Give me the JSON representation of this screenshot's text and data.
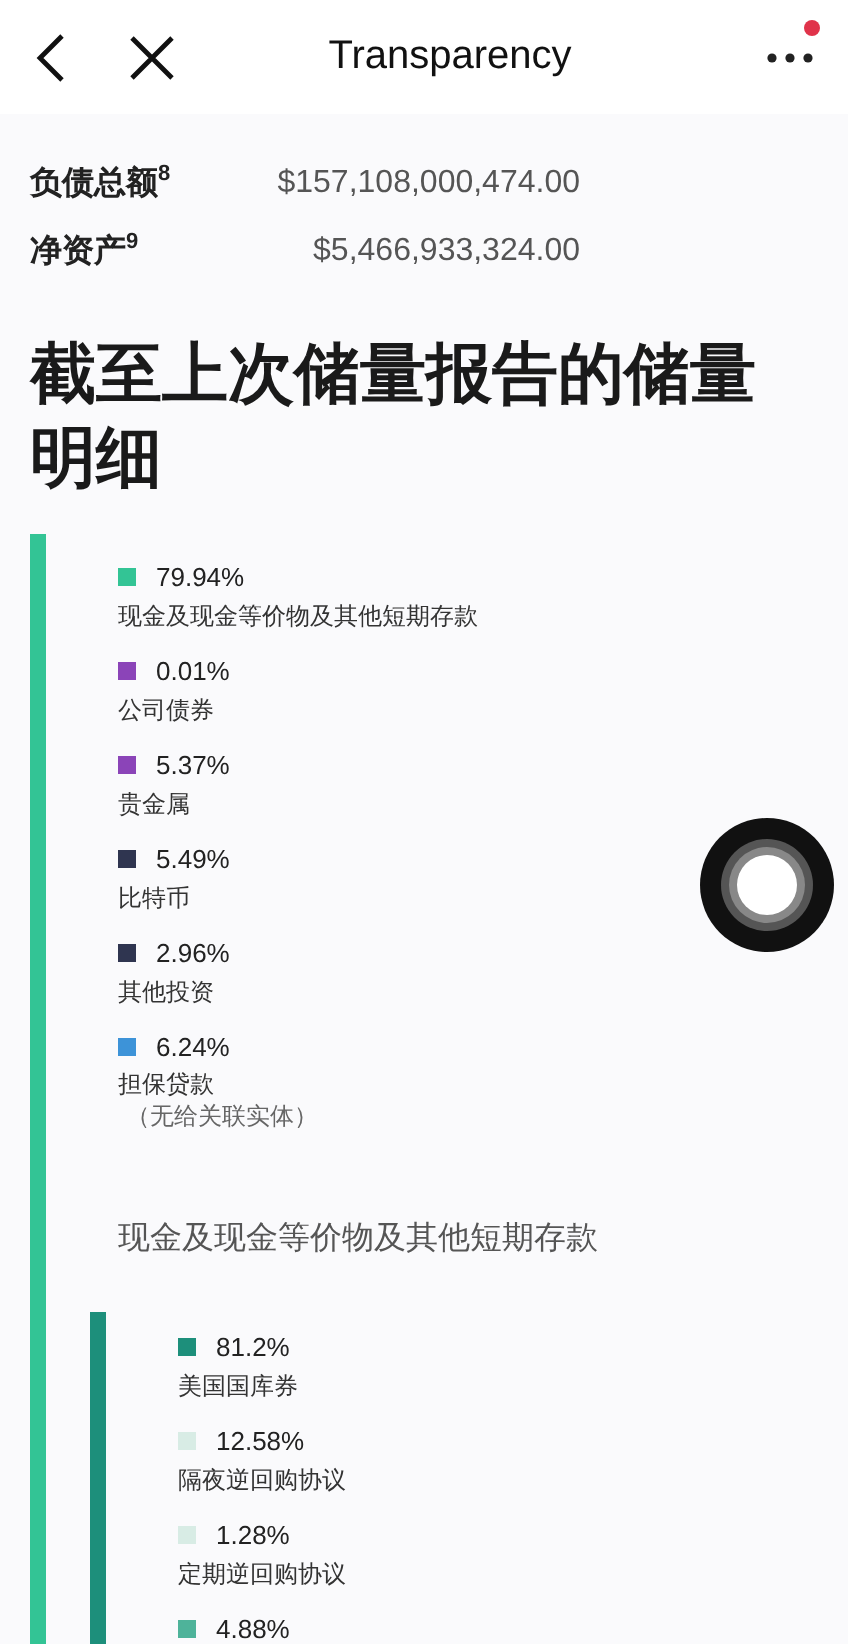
{
  "header": {
    "title": "Transparency",
    "notification": true
  },
  "summary_rows": [
    {
      "label": "负债总额$^{8}$",
      "value": "$157,108,000,474.00"
    },
    {
      "label": "净资产$^{9}$",
      "value": "$5,466,933,324.00"
    }
  ],
  "heading": "截至上次储量报告的储量明细",
  "breakdown": {
    "color": "#33c495",
    "items": [
      {
        "percent": "79.94%",
        "label": "现金及现金等价物及其他短期存款",
        "color": "#33c495"
      },
      {
        "percent": "0.01%",
        "label": "公司债券",
        "color": "#8b44b8"
      },
      {
        "percent": "5.37%",
        "label": "贵金属",
        "color": "#8b44b8"
      },
      {
        "percent": "5.49%",
        "label": "比特币",
        "color": "#2f3550"
      },
      {
        "percent": "2.96%",
        "label": "其他投资",
        "color": "#2f3550"
      },
      {
        "percent": "6.24%",
        "label": "担保贷款",
        "note": "（无给关联实体）",
        "color": "#3d93d8"
      }
    ]
  },
  "sub_section": {
    "title": "现金及现金等价物及其他短期存款",
    "color": "#1d8f7b",
    "items": [
      {
        "percent": "81.2%",
        "label": "美国国库券",
        "color": "#1d8f7b"
      },
      {
        "percent": "12.58%",
        "label": "隔夜逆回购协议",
        "color": "#d8ece5"
      },
      {
        "percent": "1.28%",
        "label": "定期逆回购协议",
        "color": "#d8ece5"
      },
      {
        "percent": "4.88%",
        "color": "#4eb39a"
      }
    ]
  }
}
